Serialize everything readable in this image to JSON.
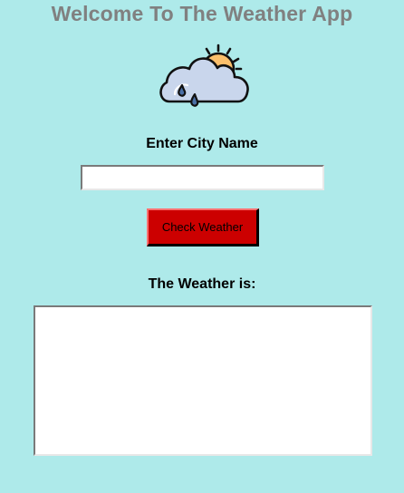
{
  "app": {
    "title": "Welcome To The Weather App",
    "logo_icon": "cloud-sun-rain-icon"
  },
  "form": {
    "city_label": "Enter City Name",
    "city_value": "",
    "city_placeholder": "",
    "check_button_label": "Check Weather"
  },
  "result": {
    "label": "The Weather is:",
    "text": ""
  },
  "colors": {
    "background": "#aeeaea",
    "title": "#808080",
    "button": "#cc0000"
  }
}
